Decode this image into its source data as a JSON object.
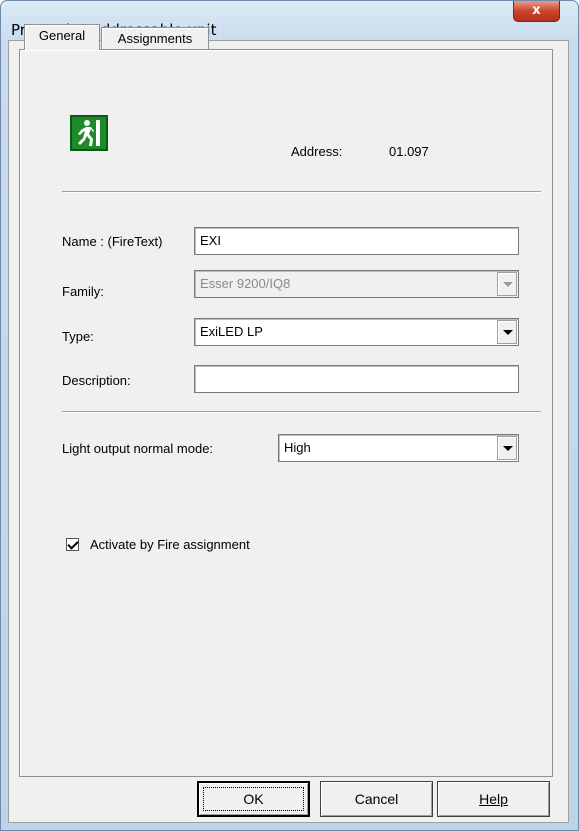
{
  "window": {
    "title": "Properties addressable unit",
    "close_label": "x"
  },
  "tabs": [
    {
      "label": "General",
      "selected": true
    },
    {
      "label": "Assignments",
      "selected": false
    }
  ],
  "general": {
    "icon": "emergency-exit-icon",
    "address_label": "Address:",
    "address_value": "01.097",
    "name_label": "Name : (FireText)",
    "name_value": "EXI",
    "family_label": "Family:",
    "family_value": "Esser 9200/IQ8",
    "type_label": "Type:",
    "type_value": "ExiLED LP",
    "description_label": "Description:",
    "description_value": "",
    "light_output_label": "Light output normal mode:",
    "light_output_value": "High",
    "activate_label": "Activate by Fire assignment",
    "activate_checked": true
  },
  "buttons": {
    "ok": "OK",
    "cancel": "Cancel",
    "help": "Help"
  },
  "colors": {
    "exit_sign": "#1f8a2a",
    "close_button": "#c8452a"
  }
}
